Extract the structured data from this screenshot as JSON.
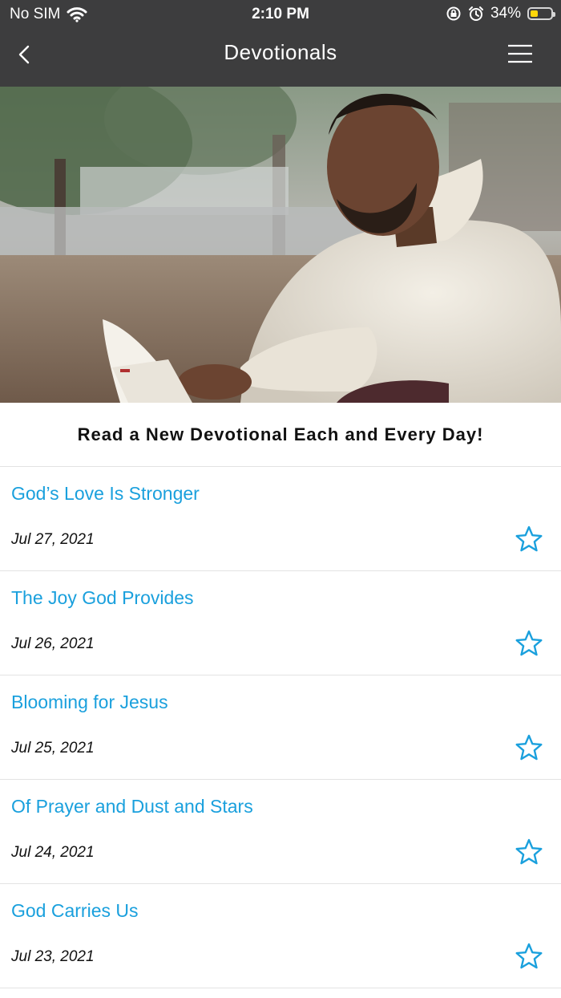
{
  "status_bar": {
    "carrier": "No SIM",
    "time": "2:10 PM",
    "battery_percent": "34%",
    "icons": [
      "wifi-icon",
      "orientation-lock-icon",
      "alarm-icon",
      "battery-icon"
    ]
  },
  "nav": {
    "title": "Devotionals",
    "back_icon": "chevron-left-icon",
    "menu_icon": "hamburger-menu-icon"
  },
  "hero": {
    "description_icon": "photo-man-reading-book"
  },
  "tagline": "Read a New Devotional Each and Every Day!",
  "devotionals": [
    {
      "title": "God’s Love Is Stronger",
      "date": "Jul 27, 2021",
      "favorited": false
    },
    {
      "title": "The Joy God Provides",
      "date": "Jul 26, 2021",
      "favorited": false
    },
    {
      "title": "Blooming for Jesus",
      "date": "Jul 25, 2021",
      "favorited": false
    },
    {
      "title": "Of Prayer and Dust and Stars",
      "date": "Jul 24, 2021",
      "favorited": false
    },
    {
      "title": "God Carries Us",
      "date": "Jul 23, 2021",
      "favorited": false
    }
  ],
  "colors": {
    "header_bg": "#3d3d3e",
    "accent": "#1aa0dd",
    "battery_fill": "#ffd60a"
  }
}
